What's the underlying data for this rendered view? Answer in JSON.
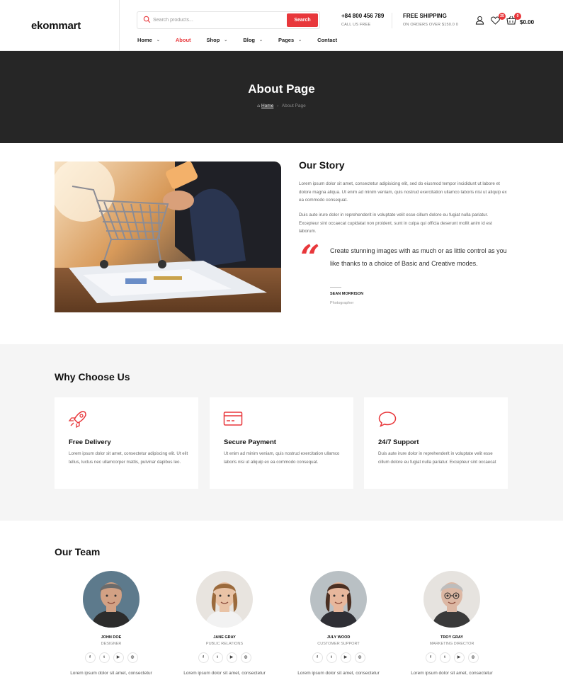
{
  "header": {
    "logo": "ekommart",
    "search": {
      "placeholder": "Search products...",
      "button": "Search"
    },
    "contact": {
      "phone": "+84 800 456 789",
      "subtitle": "CALL US FREE"
    },
    "shipping": {
      "title": "FREE SHIPPING",
      "subtitle": "ON ORDERS OVER $150.0 0"
    },
    "wishlist_count": "25",
    "cart_count": "0",
    "cart_total": "$0.00",
    "nav": [
      {
        "label": "Home",
        "dropdown": true
      },
      {
        "label": "About",
        "dropdown": false,
        "active": true
      },
      {
        "label": "Shop",
        "dropdown": true
      },
      {
        "label": "Blog",
        "dropdown": true
      },
      {
        "label": "Pages",
        "dropdown": true
      },
      {
        "label": "Contact",
        "dropdown": false
      }
    ],
    "chevron": "⌄"
  },
  "banner": {
    "title": "About Page",
    "breadcrumb": {
      "home": "Home",
      "separator": "›",
      "current": "About Page"
    }
  },
  "story": {
    "title": "Our Story",
    "paragraph1": "Lorem ipsum dolor sit amet, consectetur adipisicing elit, sed do eiusmod tempor incididunt ut labore et dolore magna aliqua. Ut enim ad minim veniam, quis nostrud exercitation ullamco laboris nisi ut aliquip ex ea commodo consequat.",
    "paragraph2": "Duis aute irure dolor in reprehenderit in voluptate velit esse cillum dolore eu fugiat nulla pariatur. Excepteur sint occaecat cupidatat non proident, sunt in culpa qui officia deserunt mollit anim id est laborum.",
    "quote_mark": "“",
    "quote": "Create stunning images with as much or as little control as you like thanks to a choice of Basic and Creative modes.",
    "author": "SEAN MORRISON",
    "author_role": "Photographer"
  },
  "why": {
    "title": "Why Choose Us",
    "cards": [
      {
        "icon": "rocket-icon",
        "title": "Free Delivery",
        "text": "Lorem ipsum dolor sit amet, consectetur adipiscing elit. Ut elit tellus, luctus nec ullamcorper mattis, pulvinar dapibus leo."
      },
      {
        "icon": "credit-card-icon",
        "title": "Secure Payment",
        "text": "Ut enim ad minim veniam, quis nostrud exercitation ullamco laboris nisi ut aliquip ex ea commodo consequat."
      },
      {
        "icon": "chat-bubble-icon",
        "title": "24/7 Support",
        "text": "Duis aute irure dolor in reprehenderit in voluptate velit esse cillum dolore eu fugiat nulla pariatur. Excepteur sint occaecat"
      }
    ],
    "accent_color": "#e8373b"
  },
  "team": {
    "title": "Our Team",
    "members": [
      {
        "name": "JOHN DOE",
        "role": "DESIGNER",
        "bio": "Lorem ipsum dolor sit amet, consectetur"
      },
      {
        "name": "JANE GRAY",
        "role": "PUBLIC RELATIONS",
        "bio": "Lorem ipsum dolor sit amet, consectetur"
      },
      {
        "name": "JULY WOOD",
        "role": "CUSTOMER SUPPORT",
        "bio": "Lorem ipsum dolor sit amet, consectetur"
      },
      {
        "name": "TROY GRAY",
        "role": "MARKETING DIRECTOR",
        "bio": "Lorem ipsum dolor sit amet, consectetur"
      }
    ],
    "socials": [
      "f",
      "t",
      "▶",
      "◎"
    ]
  }
}
